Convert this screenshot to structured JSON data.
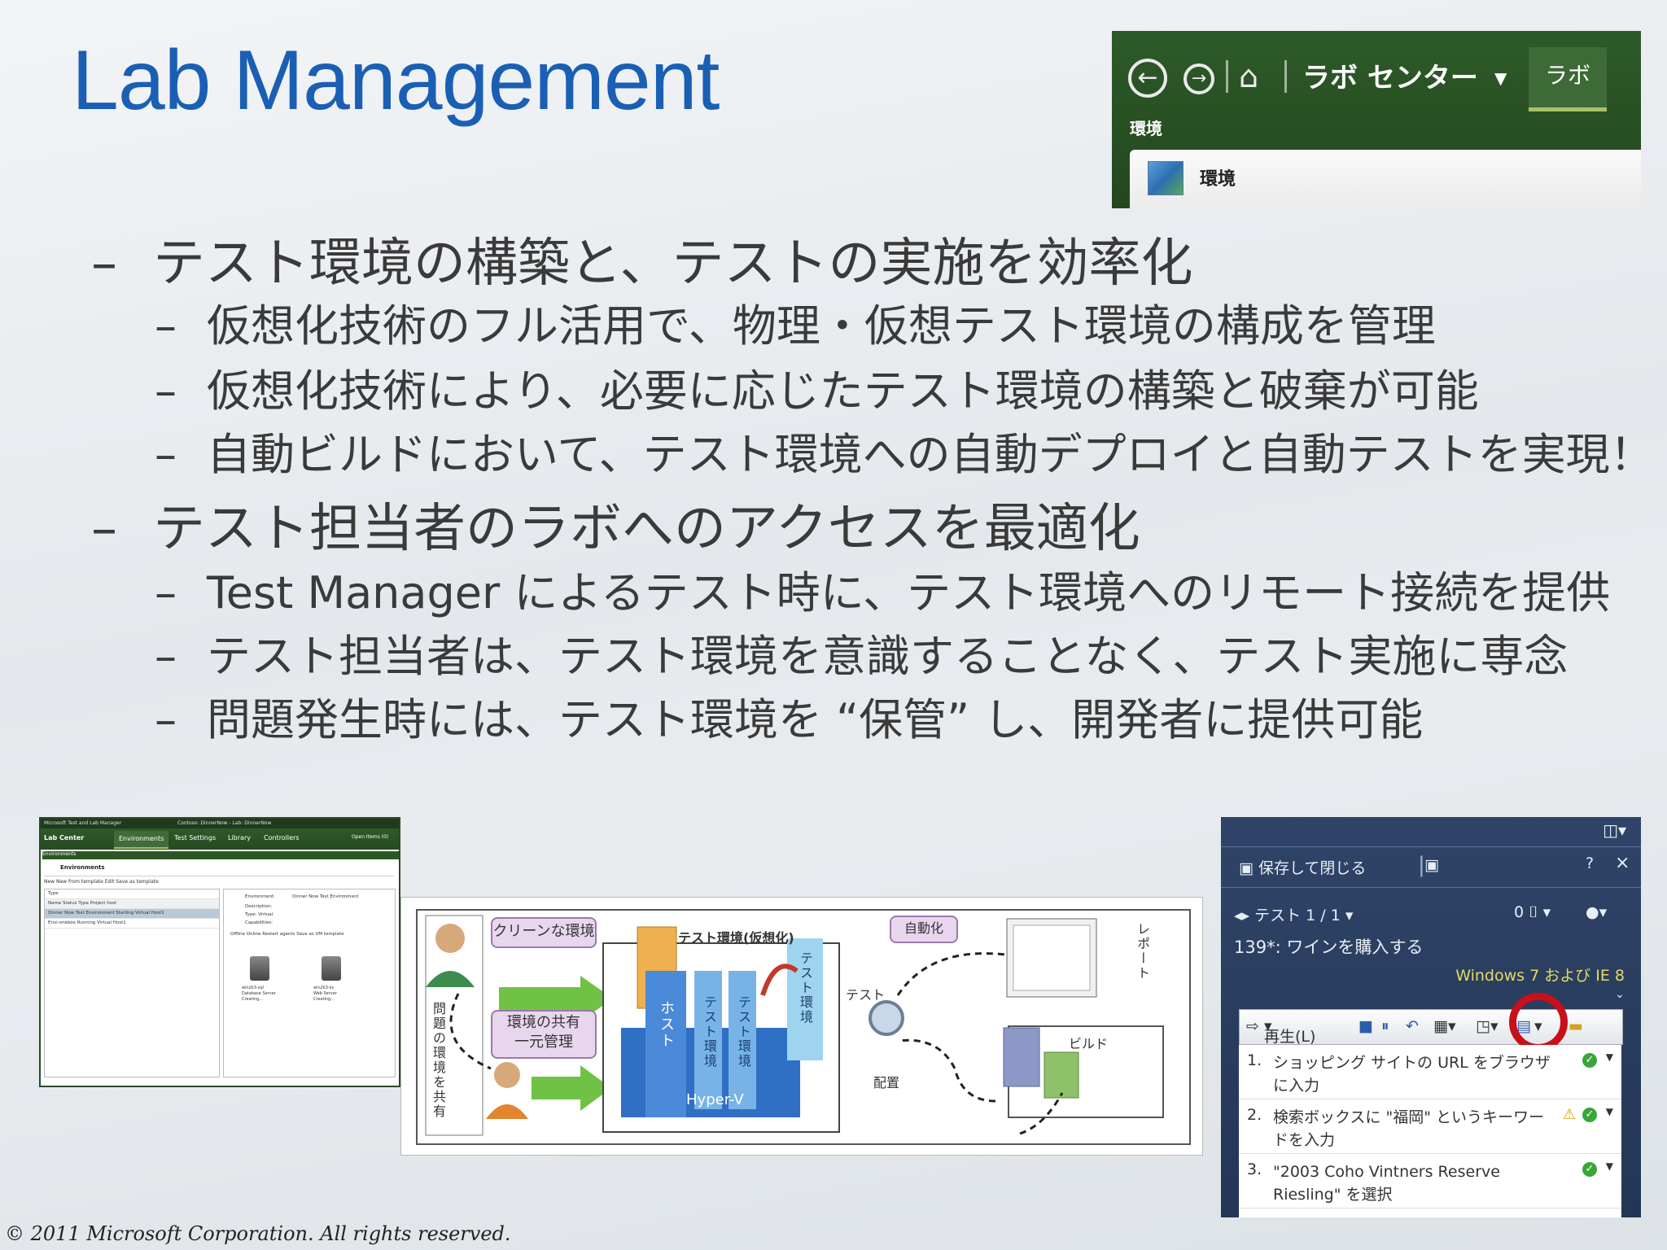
{
  "slide": {
    "title": "Lab Management",
    "copyright": "© 2011 Microsoft Corporation. All rights reserved."
  },
  "bullets": [
    {
      "level": 1,
      "text": "テスト環境の構築と、テストの実施を効率化"
    },
    {
      "level": 2,
      "text": "仮想化技術のフル活用で、物理・仮想テスト環境の構成を管理"
    },
    {
      "level": 2,
      "text": "仮想化技術により、必要に応じたテスト環境の構築と破棄が可能"
    },
    {
      "level": 2,
      "text": "自動ビルドにおいて、テスト環境への自動デプロイと自動テストを実現！"
    },
    {
      "level": 1,
      "text": "テスト担当者のラボへのアクセスを最適化"
    },
    {
      "level": 2,
      "text": "Test Manager によるテスト時に、テスト環境へのリモート接続を提供"
    },
    {
      "level": 2,
      "text": "テスト担当者は、テスト環境を意識することなく、テスト実施に専念"
    },
    {
      "level": 2,
      "text": "問題発生時には、テスト環境を “保管” し、開発者に提供可能"
    }
  ],
  "bullet_dash": "–",
  "nav_screenshot": {
    "title": "ラボ センター",
    "tab": "ラボ",
    "subheader": "環境",
    "panel_label": "環境",
    "home_icon": "⌂"
  },
  "lab_center": {
    "app_title": "Microsoft Test and Lab Manager",
    "context": "Contoso: DinnerNow - Lab: DinnerNow",
    "center": "Lab Center",
    "tabs": [
      "Environments",
      "Test Settings",
      "Library",
      "Controllers"
    ],
    "open_items": "Open Items (0)",
    "crumb": "Environments",
    "header": "Environments",
    "toolbar": "New   New from template   Edit   Save as template",
    "filter": "Type",
    "columns": "Name   Status   Type   Project host",
    "rows": [
      "Dinner Now Test Environment   Starting   Virtual   Host1",
      "Envi-onebox   Running   Virtual   Host1"
    ],
    "detail_env_label": "Environment:",
    "detail_env_value": "Dinner Now Test Environment",
    "detail_fields": [
      "Description:",
      "Type:  Virtual",
      "Capabilities:"
    ],
    "detail_actions": "Offline   Online   Restart agents   Save as VM template",
    "vm1": {
      "name": "win2k3-sql",
      "role": "Database Server",
      "status": "Creating..."
    },
    "vm2": {
      "name": "win2k3-iis",
      "role": "Web Server",
      "status": "Creating..."
    }
  },
  "diagram": {
    "clean_env": "クリーンな環境",
    "shared_env_line1": "環境の共有",
    "shared_env_line2": "一元管理",
    "test_env_virtual": "テスト環境(仮想化)",
    "automation": "自動化",
    "host": "ホスト",
    "test_env": "テスト環境",
    "hyperv": "Hyper-V",
    "test": "テスト",
    "deploy": "配置",
    "build": "ビルド",
    "report": "レポート",
    "problem_env_share": "問題の環境を共有"
  },
  "test_runner": {
    "save_close": "保存して閉じる",
    "test_counter": "テスト 1 / 1",
    "count": "0",
    "test_case": "139*: ワインを購入する",
    "environment": "Windows 7 および IE 8",
    "play": "再生(L)",
    "steps": [
      {
        "num": "1.",
        "text": "ショッピング サイトの URL をブラウザに入力",
        "warn": false
      },
      {
        "num": "2.",
        "text": "検索ボックスに \"福岡\" というキーワードを入力",
        "warn": true
      },
      {
        "num": "3.",
        "text": "\"2003 Coho Vintners Reserve Riesling\" を選択",
        "warn": false
      }
    ]
  },
  "colors": {
    "title": "#1a5fb4",
    "nav_green": "#2e5a28",
    "runner_blue": "#2f4468",
    "highlight_ring": "#c8101a"
  }
}
